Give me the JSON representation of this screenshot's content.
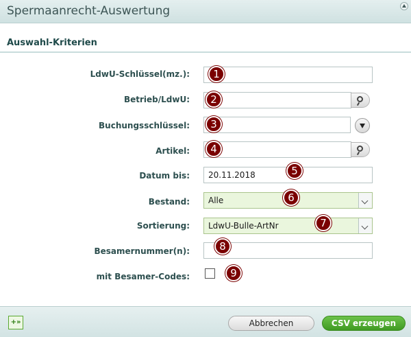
{
  "window": {
    "title": "Spermaanrecht-Auswertung"
  },
  "section": {
    "title": "Auswahl-Kriterien"
  },
  "form": {
    "ldwu_label": "LdwU-Schlüssel(mz.):",
    "ldwu_value": "",
    "betrieb_label": "Betrieb/LdwU:",
    "betrieb_value": "",
    "buchung_label": "Buchungsschlüssel:",
    "buchung_value": "",
    "artikel_label": "Artikel:",
    "artikel_value": "",
    "datum_label": "Datum bis:",
    "datum_value": "20.11.2018",
    "bestand_label": "Bestand:",
    "bestand_value": "Alle",
    "sortierung_label": "Sortierung:",
    "sortierung_value": "LdwU-Bulle-ArtNr",
    "besamer_label": "Besamernummer(n):",
    "besamer_value": "",
    "codes_label": "mit Besamer-Codes:",
    "codes_checked": false
  },
  "markers": [
    "1",
    "2",
    "3",
    "4",
    "5",
    "6",
    "7",
    "8",
    "9"
  ],
  "footer": {
    "expand_label": "+»",
    "cancel_label": "Abbrechen",
    "csv_label": "CSV erzeugen"
  },
  "icons": {
    "lookup": "magnifier-icon",
    "dropdown": "chevron-down-icon",
    "collapse": "collapse-up-icon"
  },
  "colors": {
    "marker": "#7a0000",
    "primary_button": "#4caf2c",
    "header_bg": "#d8e7e7"
  }
}
